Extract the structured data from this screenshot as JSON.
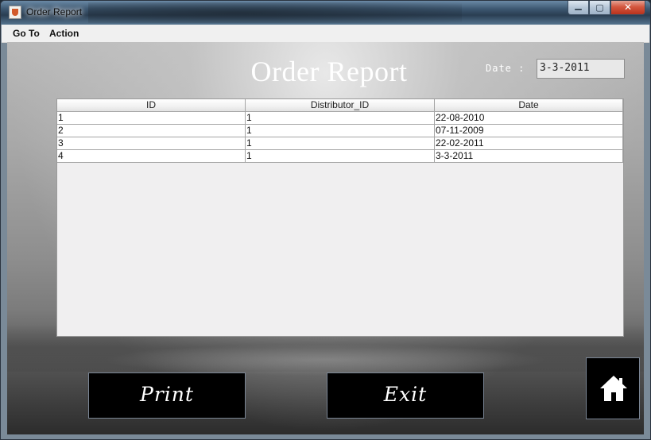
{
  "window": {
    "title": "Order Report"
  },
  "menu": {
    "items": [
      {
        "label": "Go To"
      },
      {
        "label": "Action"
      }
    ]
  },
  "report": {
    "title": "Order Report",
    "date_label": "Date :",
    "date_value": "3-3-2011"
  },
  "table": {
    "columns": [
      "ID",
      "Distributor_ID",
      "Date"
    ],
    "rows": [
      [
        "1",
        "1",
        "22-08-2010"
      ],
      [
        "2",
        "1",
        "07-11-2009"
      ],
      [
        "3",
        "1",
        "22-02-2011"
      ],
      [
        "4",
        "1",
        "3-3-2011"
      ]
    ]
  },
  "buttons": {
    "print_label": "Print",
    "exit_label": "Exit",
    "home_icon": "home-icon"
  },
  "colors": {
    "button_bg": "#000000",
    "title_text": "#ffffff"
  }
}
